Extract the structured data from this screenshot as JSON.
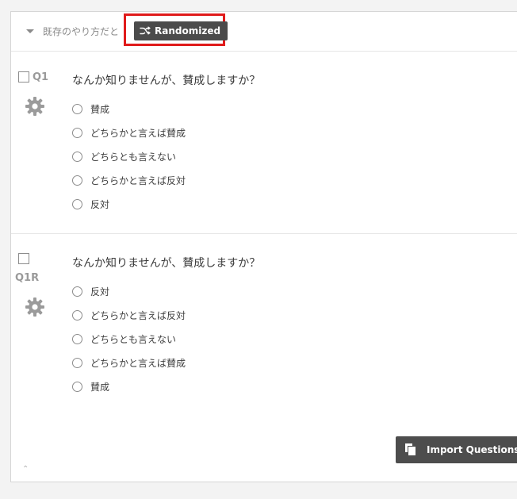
{
  "block": {
    "title": "既存のやり方だと",
    "randomized_label": "Randomized",
    "highlight_color": "#e01b1b"
  },
  "questions": [
    {
      "id": "Q1",
      "text": "なんか知りませんが、賛成しますか？",
      "choices": [
        "賛成",
        "どちらかと言えば賛成",
        "どちらとも言えない",
        "どちらかと言えば反対",
        "反対"
      ]
    },
    {
      "id": "Q1R",
      "text": "なんか知りませんが、賛成しますか？",
      "choices": [
        "反対",
        "どちらかと言えば反対",
        "どちらとも言えない",
        "どちらかと言えば賛成",
        "賛成"
      ]
    }
  ],
  "footer": {
    "import_label": "Import Questions F"
  },
  "icons": {
    "collapse": "triangle-down",
    "shuffle": "shuffle",
    "settings": "gear",
    "import": "copy",
    "scroll_up": "chevron-up"
  },
  "colors": {
    "badge_background": "#4b4b4b",
    "button_background": "#4d4d4d",
    "panel_border": "#d6d6d6"
  }
}
